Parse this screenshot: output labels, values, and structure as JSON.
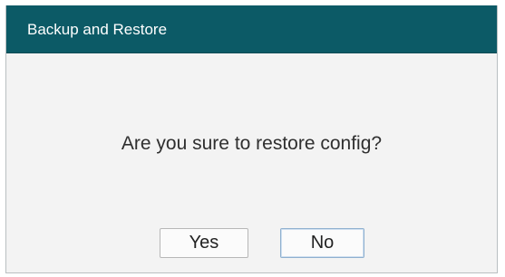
{
  "dialog": {
    "title": "Backup and Restore",
    "message": "Are you sure to restore config?",
    "buttons": {
      "yes_label": "Yes",
      "no_label": "No"
    }
  },
  "colors": {
    "titlebar": "#0c5a66",
    "title_text": "#ffffff",
    "body": "#f3f3f3",
    "focused_button_border": "#8fb0cf"
  }
}
